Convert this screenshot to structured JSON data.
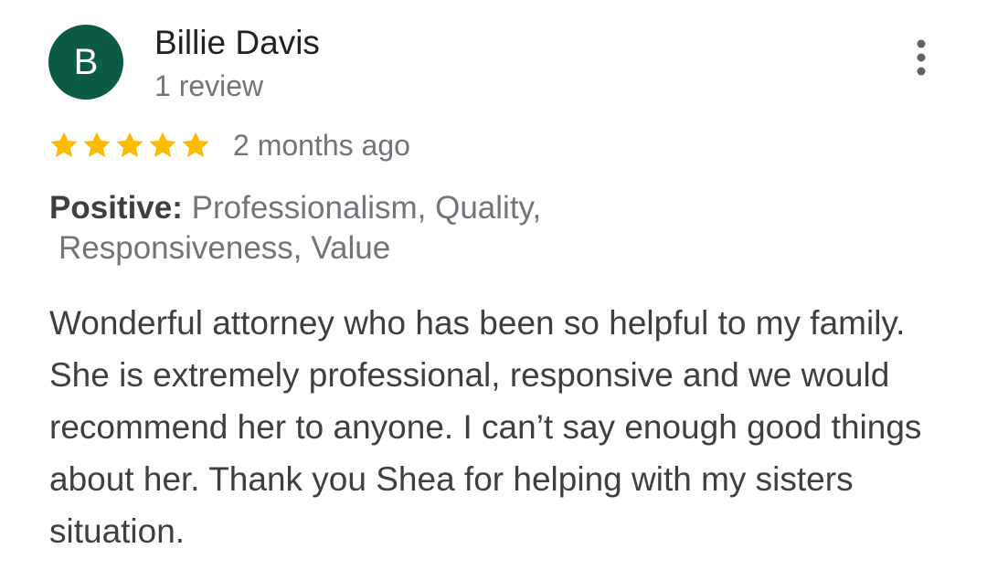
{
  "review": {
    "avatar_initial": "B",
    "avatar_color": "#0b5b47",
    "reviewer_name": "Billie Davis",
    "review_count": "1 review",
    "rating": 5,
    "rating_max": 5,
    "star_color": "#fbbc04",
    "date": "2 months ago",
    "attributes_label": "Positive:",
    "attributes_line1": "Professionalism, Quality,",
    "attributes_line2": "Responsiveness, Value",
    "text": "Wonderful attorney who has been so helpful to my family. She is extremely professional, responsive and we would recommend her to anyone. I can’t say enough good things about her. Thank you Shea for helping with my sisters situation.",
    "menu_icon": "more-vert-icon"
  }
}
